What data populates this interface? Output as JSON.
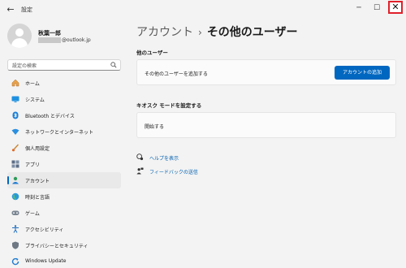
{
  "window": {
    "app_title": "設定",
    "back_icon": "←",
    "minimize_icon": "─",
    "maximize_icon": "☐",
    "close_icon": "✕"
  },
  "profile": {
    "name": "秋葉一郎",
    "email_suffix": "@outlook.jp"
  },
  "search": {
    "placeholder": "設定の検索"
  },
  "sidebar": {
    "items": [
      {
        "label": "ホーム",
        "icon": "home-icon"
      },
      {
        "label": "システム",
        "icon": "system-icon"
      },
      {
        "label": "Bluetooth とデバイス",
        "icon": "bluetooth-icon"
      },
      {
        "label": "ネットワークとインターネット",
        "icon": "network-icon"
      },
      {
        "label": "個人用設定",
        "icon": "brush-icon"
      },
      {
        "label": "アプリ",
        "icon": "apps-icon"
      },
      {
        "label": "アカウント",
        "icon": "account-icon",
        "active": true
      },
      {
        "label": "時刻と言語",
        "icon": "globe-icon"
      },
      {
        "label": "ゲーム",
        "icon": "game-icon"
      },
      {
        "label": "アクセシビリティ",
        "icon": "accessibility-icon"
      },
      {
        "label": "プライバシーとセキュリティ",
        "icon": "shield-icon"
      },
      {
        "label": "Windows Update",
        "icon": "update-icon"
      }
    ]
  },
  "main": {
    "breadcrumb_parent": "アカウント",
    "breadcrumb_sep": "›",
    "page_title": "その他のユーザー",
    "other_users": {
      "section_title": "他のユーザー",
      "row_label": "その他のユーザーを追加する",
      "button_label": "アカウントの追加"
    },
    "kiosk": {
      "section_title": "キオスク モードを設定する",
      "row_label": "開始する"
    },
    "links": {
      "help": "ヘルプを表示",
      "feedback": "フィードバックの送信"
    }
  },
  "colors": {
    "accent": "#0067c0",
    "close_highlight": "#e0212b"
  }
}
